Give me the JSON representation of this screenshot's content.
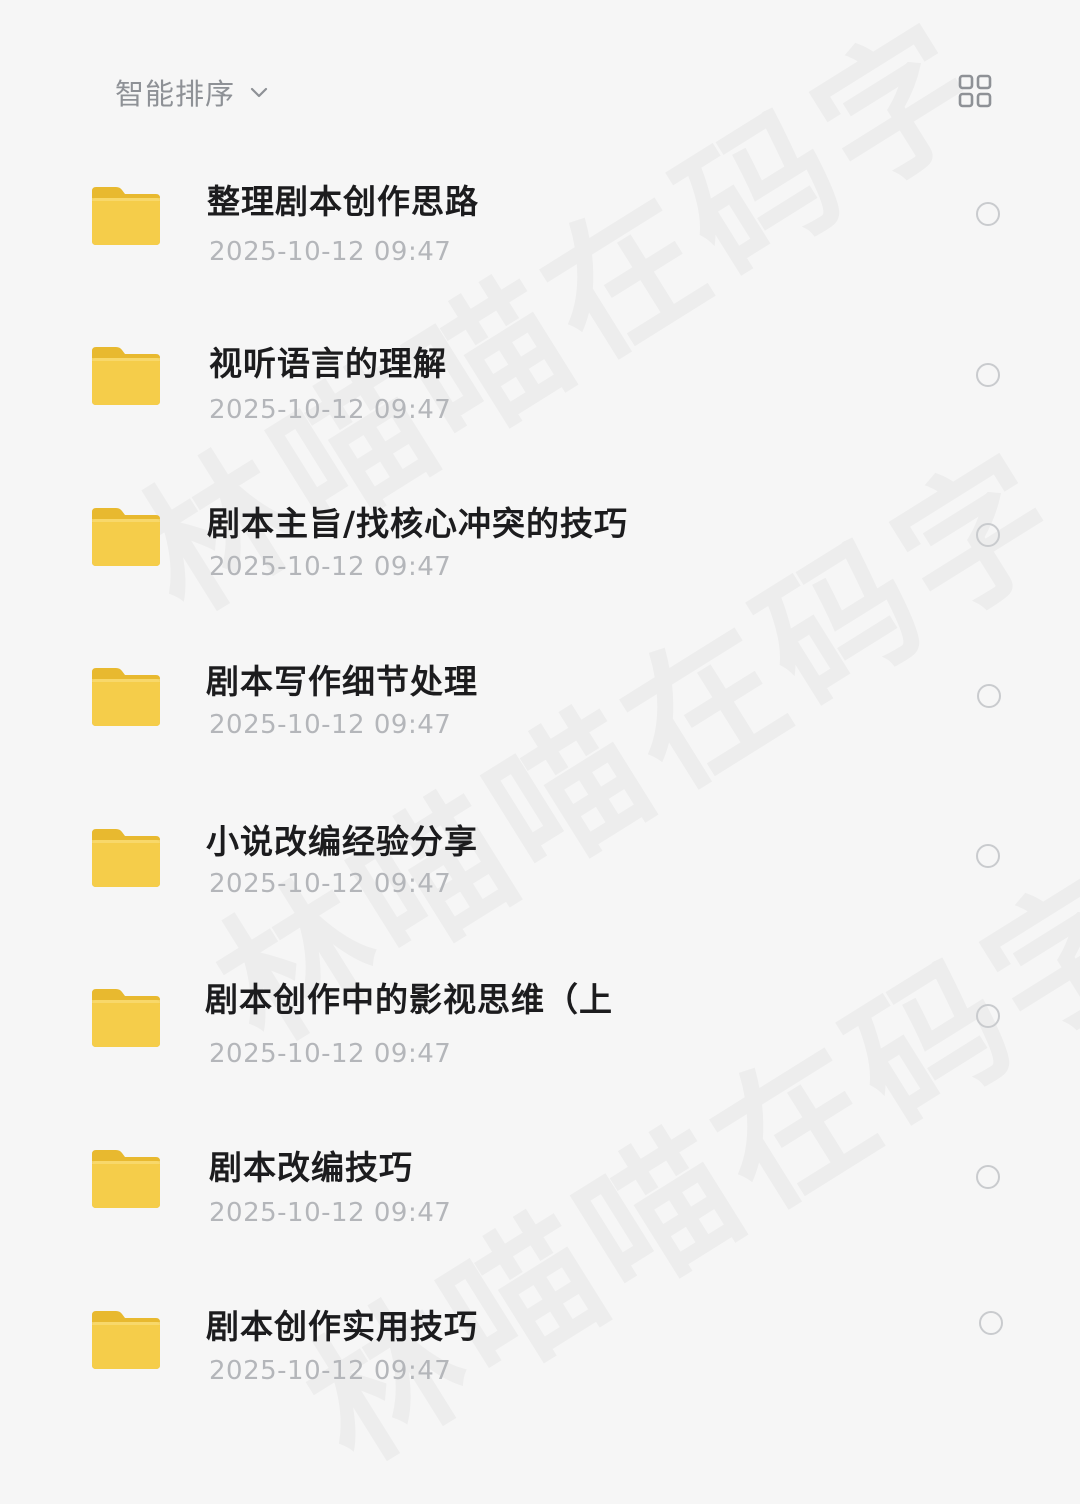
{
  "toolbar": {
    "sort_label": "智能排序",
    "sort_icon": "chevron-down-icon",
    "view_toggle_icon": "grid-view-icon"
  },
  "watermark": "林喵喵在码字",
  "folder_color": "#f5cd4a",
  "items": [
    {
      "name": "整理剧本创作思路",
      "date": "2025-10-12 09:47"
    },
    {
      "name": "视听语言的理解",
      "date": "2025-10-12 09:47"
    },
    {
      "name": "剧本主旨/找核心冲突的技巧",
      "date": "2025-10-12 09:47"
    },
    {
      "name": "剧本写作细节处理",
      "date": "2025-10-12 09:47"
    },
    {
      "name": "小说改编经验分享",
      "date": "2025-10-12 09:47"
    },
    {
      "name": "剧本创作中的影视思维（上",
      "date": "2025-10-12 09:47"
    },
    {
      "name": "剧本改编技巧",
      "date": "2025-10-12 09:47"
    },
    {
      "name": "剧本创作实用技巧",
      "date": "2025-10-12 09:47"
    }
  ]
}
